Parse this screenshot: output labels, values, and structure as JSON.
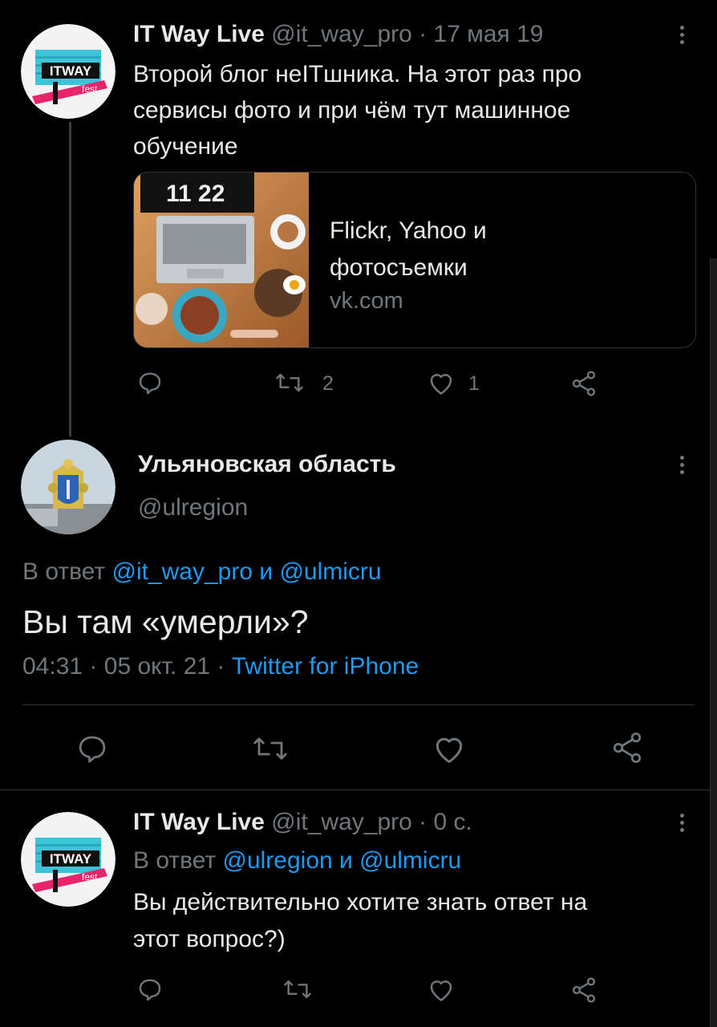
{
  "colors": {
    "background": "#000000",
    "text": "#e7e9ea",
    "muted": "#71767b",
    "link": "#1d9bf0",
    "border": "#2f3336"
  },
  "tweet1": {
    "display_name": "IT Way Live",
    "handle": "@it_way_pro",
    "separator": "·",
    "date": "17 мая 19",
    "text_lines": [
      "Второй блог неITшника. На этот раз про",
      "сервисы фото и при чём тут машинное",
      "обучение"
    ],
    "avatar": {
      "logo_word": "ITWAY",
      "logo_sub": "fest"
    },
    "card": {
      "image_text": "11 22",
      "title_lines": [
        "Flickr, Yahoo и",
        "фотосъемки"
      ],
      "domain": "vk.com"
    },
    "actions": {
      "reply_icon": "reply-icon",
      "retweet_icon": "retweet-icon",
      "retweets": "2",
      "like_icon": "heart-icon",
      "likes": "1",
      "share_icon": "share-icon"
    }
  },
  "tweet2": {
    "display_name": "Ульяновская область",
    "handle": "@ulregion",
    "reply_prefix": "В ответ",
    "reply_users": "@it_way_pro и @ulmicru",
    "text": "Вы там «умерли»?",
    "time": "04:31",
    "date": "05 окт. 21",
    "source": "Twitter for iPhone",
    "actions": {
      "reply_icon": "reply-icon",
      "retweet_icon": "retweet-icon",
      "like_icon": "heart-icon",
      "share_icon": "share-icon"
    }
  },
  "tweet3": {
    "display_name": "IT Way Live",
    "handle": "@it_way_pro",
    "separator": "·",
    "date": "0 с.",
    "reply_prefix": "В ответ",
    "reply_users": "@ulregion и @ulmicru",
    "text_lines": [
      "Вы действительно хотите знать ответ на",
      "этот вопрос?)"
    ],
    "avatar": {
      "logo_word": "ITWAY",
      "logo_sub": "fest"
    },
    "actions": {
      "reply_icon": "reply-icon",
      "retweet_icon": "retweet-icon",
      "like_icon": "heart-icon",
      "share_icon": "share-icon"
    }
  }
}
